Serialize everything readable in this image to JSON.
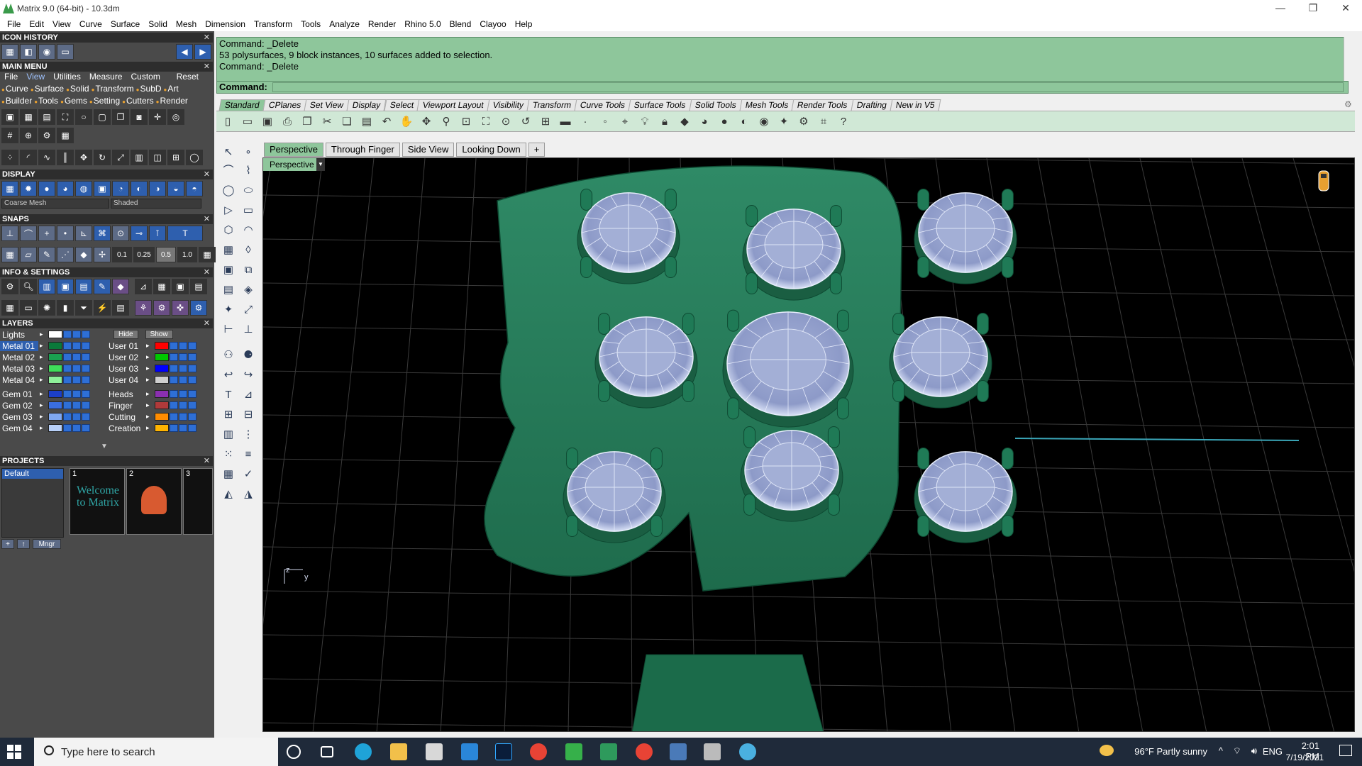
{
  "window": {
    "title": "Matrix 9.0 (64-bit) - 10.3dm",
    "controls": [
      "—",
      "❐",
      "✕"
    ]
  },
  "menubar": [
    "File",
    "Edit",
    "View",
    "Curve",
    "Surface",
    "Solid",
    "Mesh",
    "Dimension",
    "Transform",
    "Tools",
    "Analyze",
    "Render",
    "Rhino 5.0",
    "Blend",
    "Clayoo",
    "Help"
  ],
  "left_panel": {
    "icon_history": "ICON HISTORY",
    "main_menu": {
      "title": "MAIN MENU",
      "tabs": [
        "File",
        "View",
        "Utilities",
        "Measure",
        "Custom",
        "Reset"
      ],
      "row1": [
        "Curve",
        "Surface",
        "Solid",
        "Transform",
        "SubD",
        "Art"
      ],
      "row2": [
        "Builder",
        "Tools",
        "Gems",
        "Setting",
        "Cutters",
        "Render"
      ]
    },
    "display": {
      "title": "DISPLAY",
      "mesh_combo": "Coarse Mesh",
      "shade_combo": "Shaded"
    },
    "snaps": {
      "title": "SNAPS",
      "values": [
        "0.1",
        "0.25",
        "0.5",
        "1.0"
      ]
    },
    "info": {
      "title": "INFO & SETTINGS"
    },
    "layers": {
      "title": "LAYERS",
      "lights": "Lights",
      "hide": "Hide",
      "show": "Show",
      "left": [
        {
          "name": "Metal 01",
          "color": "#0a7a3a"
        },
        {
          "name": "Metal 02",
          "color": "#1aa050"
        },
        {
          "name": "Metal 03",
          "color": "#3fdc5a"
        },
        {
          "name": "Metal 04",
          "color": "#8ef09a"
        },
        {
          "name": "Gem 01",
          "color": "#1c3fc8"
        },
        {
          "name": "Gem 02",
          "color": "#3a6ee0"
        },
        {
          "name": "Gem 03",
          "color": "#7fa8f0"
        },
        {
          "name": "Gem 04",
          "color": "#b8d0f8"
        }
      ],
      "right": [
        {
          "name": "User 01",
          "color": "#ff0000"
        },
        {
          "name": "User 02",
          "color": "#00c800"
        },
        {
          "name": "User 03",
          "color": "#0000ff"
        },
        {
          "name": "User 04",
          "color": "#cfcfcf"
        },
        {
          "name": "Heads",
          "color": "#8a2fb0"
        },
        {
          "name": "Finger",
          "color": "#b03a3a"
        },
        {
          "name": "Cutting",
          "color": "#ff8c00"
        },
        {
          "name": "Creation",
          "color": "#ffb400"
        }
      ]
    },
    "projects": {
      "title": "PROJECTS",
      "default": "Default",
      "thumb1_num": "1",
      "thumb1_text": "Welcome to Matrix",
      "thumb2_num": "2",
      "thumb3_num": "3",
      "mngr": "Mngr"
    }
  },
  "command": {
    "lines": [
      "Command: _Delete",
      "53 polysurfaces, 9 block instances, 10 surfaces added to selection.",
      "Command: _Delete"
    ],
    "prompt": "Command:"
  },
  "toolbar_tabs": [
    "Standard",
    "CPlanes",
    "Set View",
    "Display",
    "Select",
    "Viewport Layout",
    "Visibility",
    "Transform",
    "Curve Tools",
    "Surface Tools",
    "Solid Tools",
    "Mesh Tools",
    "Render Tools",
    "Drafting",
    "New in V5"
  ],
  "view_tabs": [
    "Perspective",
    "Through Finger",
    "Side View",
    "Looking Down",
    "+"
  ],
  "viewport": {
    "label": "Perspective",
    "axis_z": "z",
    "axis_y": "y"
  },
  "taskbar": {
    "search_placeholder": "Type here to search",
    "weather": "96°F  Partly sunny",
    "lang": "ENG",
    "time": "2:01 PM",
    "date": "7/19/2021"
  }
}
